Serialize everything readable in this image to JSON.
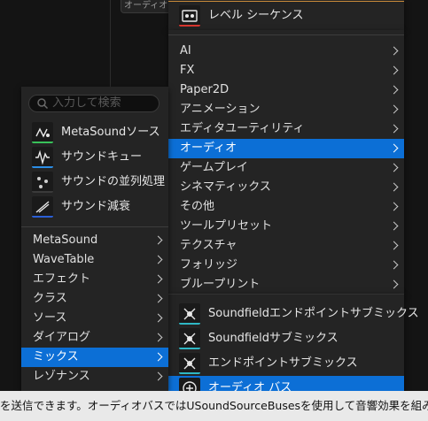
{
  "background": {
    "node_label": "オーディオバ"
  },
  "top_menu": {
    "items": [
      {
        "label": "レベル シーケンス"
      }
    ]
  },
  "right_menu": {
    "items": [
      {
        "label": "AI",
        "selected": false
      },
      {
        "label": "FX",
        "selected": false
      },
      {
        "label": "Paper2D",
        "selected": false
      },
      {
        "label": "アニメーション",
        "selected": false
      },
      {
        "label": "エディタユーティリティ",
        "selected": false
      },
      {
        "label": "オーディオ",
        "selected": true
      },
      {
        "label": "ゲームプレイ",
        "selected": false
      },
      {
        "label": "シネマティックス",
        "selected": false
      },
      {
        "label": "その他",
        "selected": false
      },
      {
        "label": "ツールプリセット",
        "selected": false
      },
      {
        "label": "テクスチャ",
        "selected": false
      },
      {
        "label": "フォリッジ",
        "selected": false
      },
      {
        "label": "ブループリント",
        "selected": false
      }
    ]
  },
  "left_menu": {
    "search_placeholder": "入力して検索",
    "assets": [
      {
        "label": "MetaSoundソース",
        "icon": "metasound-source-icon",
        "bar_color": "#39c25a"
      },
      {
        "label": "サウンドキュー",
        "icon": "sound-cue-icon",
        "bar_color": "#2b8ee6"
      },
      {
        "label": "サウンドの並列処理",
        "icon": "sound-concurrency-icon",
        "bar_color": "#3a3a3a"
      },
      {
        "label": "サウンド減衰",
        "icon": "sound-attenuation-icon",
        "bar_color": "#2b5fd6"
      }
    ],
    "categories": [
      {
        "label": "MetaSound",
        "selected": false
      },
      {
        "label": "WaveTable",
        "selected": false
      },
      {
        "label": "エフェクト",
        "selected": false
      },
      {
        "label": "クラス",
        "selected": false
      },
      {
        "label": "ソース",
        "selected": false
      },
      {
        "label": "ダイアログ",
        "selected": false
      },
      {
        "label": "ミックス",
        "selected": true
      },
      {
        "label": "レゾナンス",
        "selected": false
      }
    ]
  },
  "sub_menu": {
    "items": [
      {
        "label": "Soundfieldエンドポイントサブミックス",
        "icon": "soundfield-endpoint-submix-icon",
        "bar_color": "#2fb7c4",
        "selected": false
      },
      {
        "label": "Soundfieldサブミックス",
        "icon": "soundfield-submix-icon",
        "bar_color": "#2fb7c4",
        "selected": false
      },
      {
        "label": "エンドポイントサブミックス",
        "icon": "endpoint-submix-icon",
        "bar_color": "#2fb7c4",
        "selected": false
      },
      {
        "label": "オーディオ バス",
        "icon": "audio-bus-icon",
        "bar_color": "#2fb7c4",
        "selected": true
      }
    ]
  },
  "status_bar": {
    "text": "を送信できます。オーディオバスではUSoundSourceBusesを使用して音響効果を組み込むことがで"
  },
  "colors": {
    "selection": "#0c6fd6",
    "menu_bg": "#242424"
  }
}
